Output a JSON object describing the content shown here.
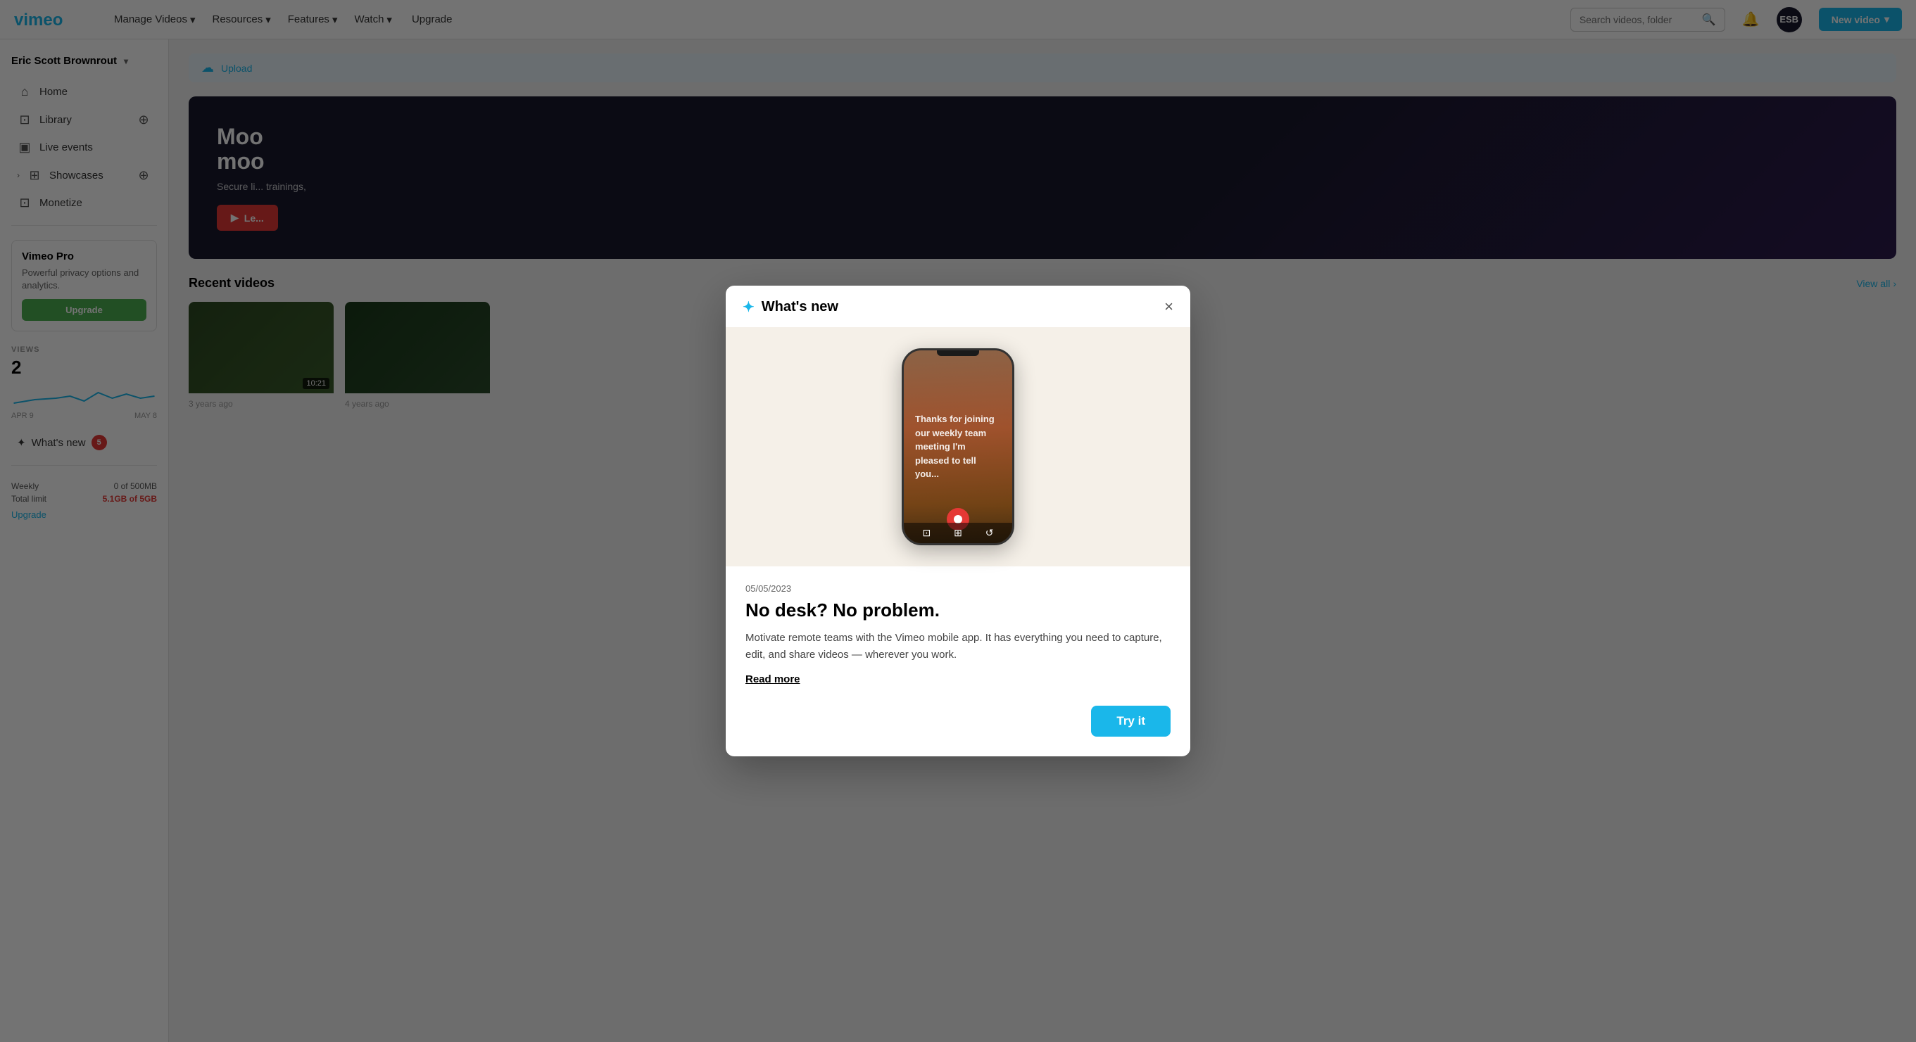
{
  "app": {
    "name": "Vimeo"
  },
  "topnav": {
    "manage_videos": "Manage Videos",
    "resources": "Resources",
    "features": "Features",
    "watch": "Watch",
    "upgrade": "Upgrade",
    "search_placeholder": "Search videos, folder",
    "new_video": "New video",
    "user_initials": "ESB"
  },
  "sidebar": {
    "user_name": "Eric Scott Brownrout",
    "home": "Home",
    "library": "Library",
    "live_events": "Live events",
    "showcases": "Showcases",
    "monetize": "Monetize",
    "promo": {
      "title": "Vimeo Pro",
      "text": "Powerful privacy options and analytics.",
      "button": "Upgrade"
    },
    "stats": {
      "label": "VIEWS",
      "count": "2",
      "date_start": "APR 9",
      "date_end": "MAY 8"
    },
    "whats_new": "What's new",
    "whats_new_badge": "5",
    "footer": {
      "weekly_label": "Weekly",
      "weekly_value": "0 of 500MB",
      "total_label": "Total limit",
      "total_value": "5.1GB of 5GB",
      "upgrade_link": "Upgrade"
    }
  },
  "main": {
    "upload_text": "Upload",
    "hero": {
      "title_line1": "Moo",
      "title_line2": "moo",
      "subtitle": "Secure li... trainings,",
      "button": "Le..."
    },
    "recent": {
      "title": "Recent videos",
      "view_all": "View all",
      "videos": [
        {
          "duration": "10:21",
          "meta": "3 years ago"
        },
        {
          "meta": "4 years ago"
        }
      ]
    }
  },
  "modal": {
    "title": "What's new",
    "date": "05/05/2023",
    "headline": "No desk? No problem.",
    "description": "Motivate remote teams with the Vimeo mobile app. It has everything you need to capture, edit, and share videos — wherever you work.",
    "read_more": "Read more",
    "try_it": "Try it",
    "phone_text": "Thanks for joining our weekly team meeting I'm pleased to tell you..."
  }
}
